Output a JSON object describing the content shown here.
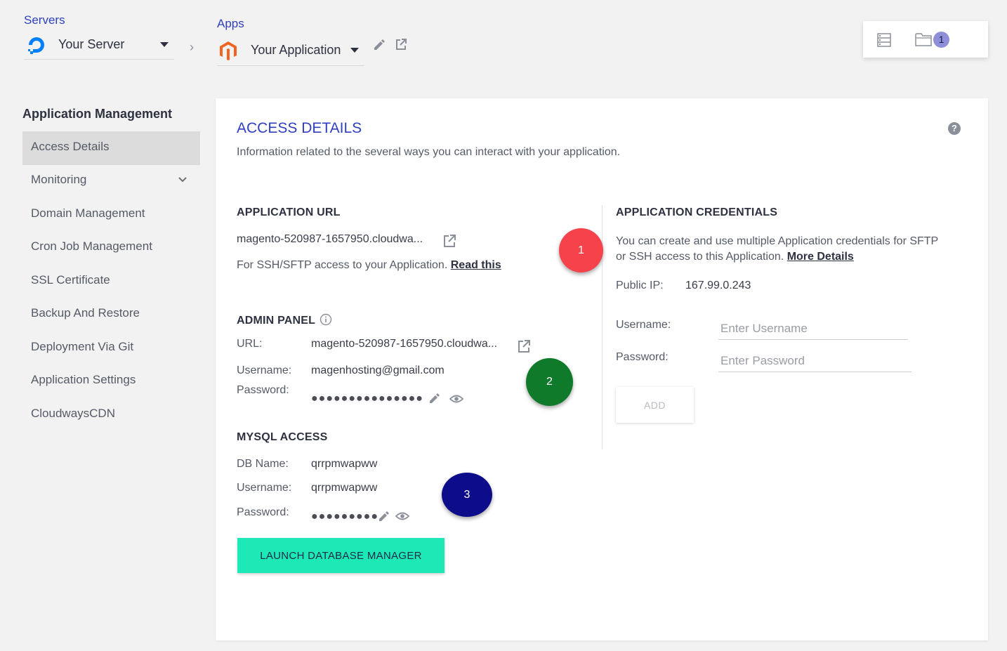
{
  "header": {
    "servers_label": "Servers",
    "server_name": "Your Server",
    "apps_label": "Apps",
    "app_name": "Your Application",
    "notification_count": "1"
  },
  "sidebar": {
    "title": "Application Management",
    "items": [
      {
        "label": "Access Details",
        "active": true
      },
      {
        "label": "Monitoring",
        "has_submenu": true
      },
      {
        "label": "Domain Management"
      },
      {
        "label": "Cron Job Management"
      },
      {
        "label": "SSL Certificate"
      },
      {
        "label": "Backup And Restore"
      },
      {
        "label": "Deployment Via Git"
      },
      {
        "label": "Application Settings"
      },
      {
        "label": "CloudwaysCDN"
      }
    ]
  },
  "main": {
    "title": "ACCESS DETAILS",
    "description": "Information related to the several ways you can interact with your application.",
    "help_icon": "?",
    "app_url": {
      "title": "APPLICATION URL",
      "url": "magento-520987-1657950.cloudwa...",
      "ssh_text": "For SSH/SFTP access to your Application.",
      "ssh_link": "Read this"
    },
    "admin_panel": {
      "title": "ADMIN PANEL",
      "url_label": "URL:",
      "url": "magento-520987-1657950.cloudwa...",
      "username_label": "Username:",
      "username": "magenhosting@gmail.com",
      "password_label": "Password:",
      "password_mask": "●●●●●●●●●●●●●●●"
    },
    "mysql": {
      "title": "MYSQL ACCESS",
      "db_label": "DB Name:",
      "db_name": "qrrpmwapww",
      "username_label": "Username:",
      "username": "qrrpmwapww",
      "password_label": "Password:",
      "password_mask": "●●●●●●●●●",
      "launch_button": "LAUNCH DATABASE MANAGER"
    },
    "credentials": {
      "title": "APPLICATION CREDENTIALS",
      "desc_line1": "You can create and use multiple Application credentials for SFTP",
      "desc_line2": "or SSH access to this Application.",
      "more_link": "More Details",
      "public_ip_label": "Public IP:",
      "public_ip": "167.99.0.243",
      "username_label": "Username:",
      "username_placeholder": "Enter Username",
      "password_label": "Password:",
      "password_placeholder": "Enter Password",
      "add_button": "ADD"
    }
  },
  "markers": [
    {
      "label": "1",
      "color": "#f5424b"
    },
    {
      "label": "2",
      "color": "#0f7a2a"
    },
    {
      "label": "3",
      "color": "#0d0c8a"
    }
  ],
  "colors": {
    "accent": "#2f3fbf",
    "launch": "#1de9b6",
    "badge": "#8e8ed9"
  }
}
